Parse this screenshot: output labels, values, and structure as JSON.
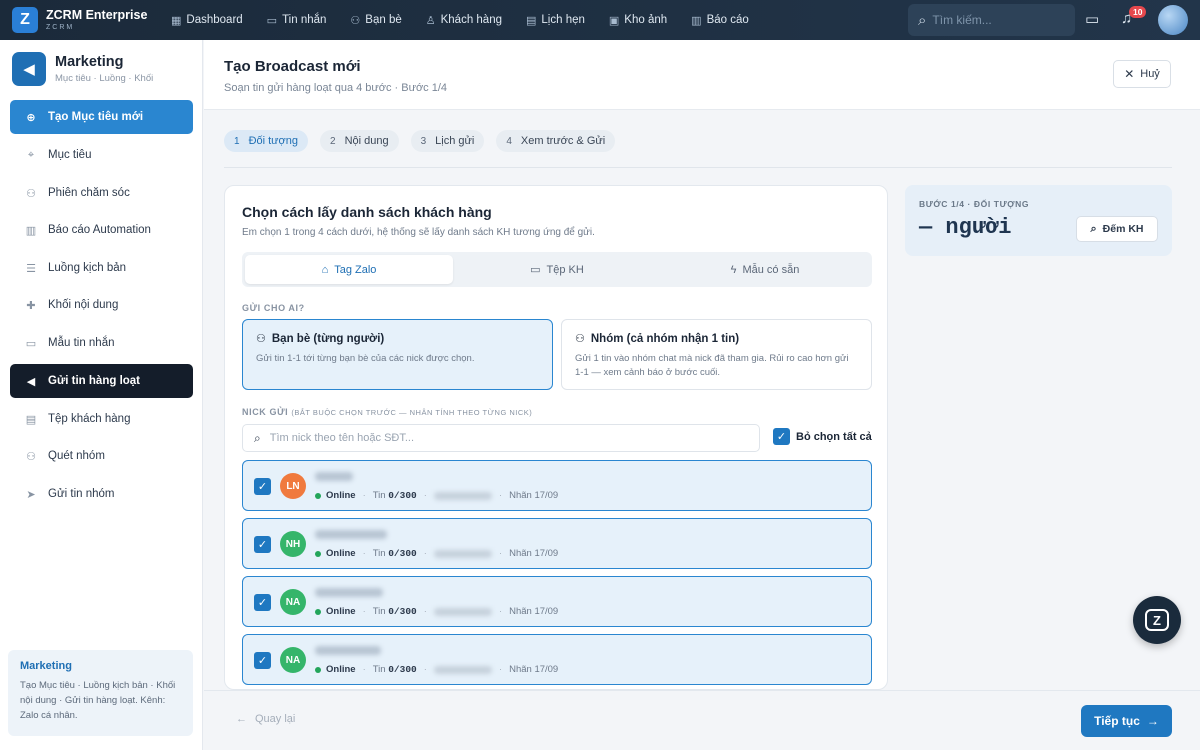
{
  "brand": {
    "name": "ZCRM Enterprise",
    "sub": "ZCRM",
    "logo_letter": "Z"
  },
  "topnav": [
    {
      "label": "Dashboard",
      "icon": "grid-icon"
    },
    {
      "label": "Tin nhắn",
      "icon": "chat-icon"
    },
    {
      "label": "Bạn bè",
      "icon": "users-icon"
    },
    {
      "label": "Khách hàng",
      "icon": "user-icon"
    },
    {
      "label": "Lịch hẹn",
      "icon": "calendar-icon"
    },
    {
      "label": "Kho ảnh",
      "icon": "image-icon"
    },
    {
      "label": "Báo cáo",
      "icon": "report-icon"
    }
  ],
  "search": {
    "placeholder": "Tìm kiếm..."
  },
  "notifications": {
    "count": "10"
  },
  "sidebar": {
    "title": "Marketing",
    "subtitle": "Mục tiêu · Luồng · Khối",
    "items": [
      {
        "label": "Tạo Mục tiêu mới",
        "icon": "plus-circle-icon"
      },
      {
        "label": "Mục tiêu",
        "icon": "target-icon"
      },
      {
        "label": "Phiên chăm sóc",
        "icon": "user-plus-icon"
      },
      {
        "label": "Báo cáo Automation",
        "icon": "chart-icon"
      },
      {
        "label": "Luồng kịch bản",
        "icon": "list-icon"
      },
      {
        "label": "Khối nội dung",
        "icon": "puzzle-icon"
      },
      {
        "label": "Mẫu tin nhắn",
        "icon": "message-icon"
      },
      {
        "label": "Gửi tin hàng loạt",
        "icon": "megaphone-icon"
      },
      {
        "label": "Tệp khách hàng",
        "icon": "folder-user-icon"
      },
      {
        "label": "Quét nhóm",
        "icon": "group-icon"
      },
      {
        "label": "Gửi tin nhóm",
        "icon": "send-icon"
      }
    ],
    "footer": {
      "title": "Marketing",
      "text": "Tạo Mục tiêu · Luồng kịch bản · Khối nội dung · Gửi tin hàng loạt. Kênh: Zalo cá nhân."
    }
  },
  "header": {
    "title": "Tạo Broadcast mới",
    "subtitle": "Soạn tin gửi hàng loạt qua 4 bước · Bước 1/4",
    "cancel_label": "Huỷ"
  },
  "steps": [
    {
      "num": "1",
      "label": "Đối tượng"
    },
    {
      "num": "2",
      "label": "Nội dung"
    },
    {
      "num": "3",
      "label": "Lịch gửi"
    },
    {
      "num": "4",
      "label": "Xem trước & Gửi"
    }
  ],
  "card": {
    "title": "Chọn cách lấy danh sách khách hàng",
    "subtitle": "Em chọn 1 trong 4 cách dưới, hệ thống sẽ lấy danh sách KH tương ứng để gửi.",
    "tabs": [
      {
        "label": "Tag Zalo",
        "icon": "tag-icon"
      },
      {
        "label": "Tệp KH",
        "icon": "folder-icon"
      },
      {
        "label": "Mẫu có sẵn",
        "icon": "bolt-icon"
      }
    ],
    "send_to_label": "GỬI CHO AI?",
    "choices": [
      {
        "title": "Bạn bè (từng người)",
        "desc": "Gửi tin 1-1 tới từng bạn bè của các nick được chọn."
      },
      {
        "title": "Nhóm (cả nhóm nhận 1 tin)",
        "desc": "Gửi 1 tin vào nhóm chat mà nick đã tham gia. Rủi ro cao hơn gửi 1-1 — xem cảnh báo ở bước cuối."
      }
    ],
    "nick_label": "NICK GỬI",
    "nick_label_note": "(BẮT BUỘC CHỌN TRƯỚC — NHÂN TÍNH THEO TỪNG NICK)",
    "nick_search_placeholder": "Tìm nick theo tên hoặc SĐT...",
    "select_all_label": "Bỏ chọn tất cả",
    "nicks": [
      {
        "initials": "LN",
        "color": "#f07a3e",
        "status": "Online",
        "msg_label": "Tin",
        "msg_count": "0/300",
        "note": "Nhãn 17/09"
      },
      {
        "initials": "NH",
        "color": "#35b56a",
        "status": "Online",
        "msg_label": "Tin",
        "msg_count": "0/300",
        "note": "Nhãn 17/09"
      },
      {
        "initials": "NA",
        "color": "#35b56a",
        "status": "Online",
        "msg_label": "Tin",
        "msg_count": "0/300",
        "note": "Nhãn 17/09"
      },
      {
        "initials": "NA",
        "color": "#35b56a",
        "status": "Online",
        "msg_label": "Tin",
        "msg_count": "0/300",
        "note": "Nhãn 17/09"
      }
    ]
  },
  "summary": {
    "label": "BƯỚC 1/4 · ĐỐI TƯỢNG",
    "value": "— người",
    "count_label": "Đếm KH"
  },
  "footer": {
    "back_label": "Quay lại",
    "next_label": "Tiếp tục"
  },
  "colors": {
    "primary": "#2a86d0",
    "dark": "#141d2a",
    "online": "#23a55a"
  }
}
